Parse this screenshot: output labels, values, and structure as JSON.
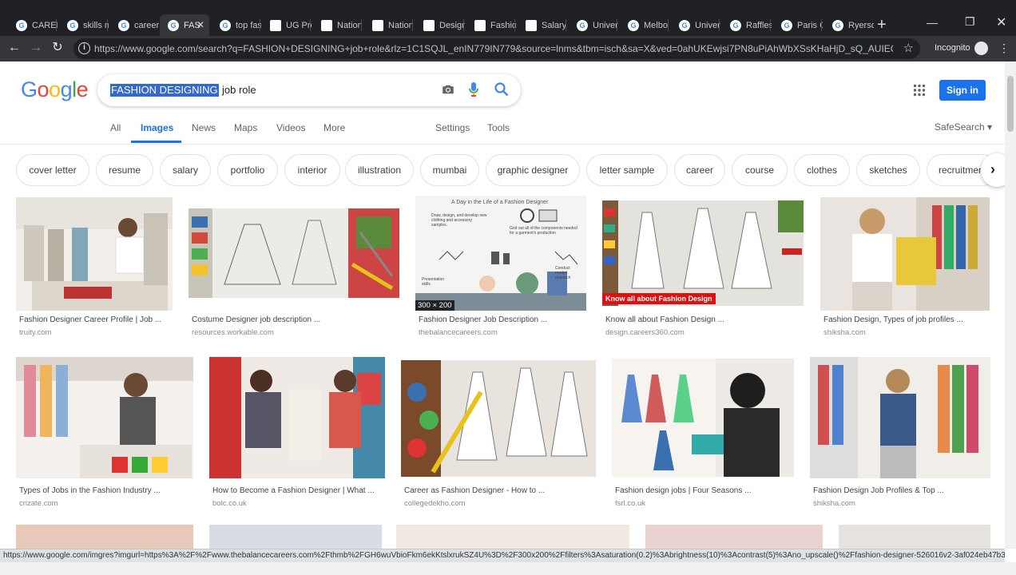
{
  "tabs": [
    {
      "label": "CAREE",
      "icon": "google"
    },
    {
      "label": "skills n",
      "icon": "google"
    },
    {
      "label": "career",
      "icon": "google"
    },
    {
      "label": "FAS",
      "icon": "google",
      "active": true
    },
    {
      "label": "top fas",
      "icon": "google"
    },
    {
      "label": "UG Pro",
      "icon": "site"
    },
    {
      "label": "Nation",
      "icon": "site"
    },
    {
      "label": "Nation",
      "icon": "site"
    },
    {
      "label": "Design",
      "icon": "site"
    },
    {
      "label": "Fashion",
      "icon": "site"
    },
    {
      "label": "Salary",
      "icon": "site"
    },
    {
      "label": "Univer",
      "icon": "google"
    },
    {
      "label": "Melbo",
      "icon": "google"
    },
    {
      "label": "Univer",
      "icon": "google"
    },
    {
      "label": "Raffles",
      "icon": "google"
    },
    {
      "label": "Paris C",
      "icon": "google"
    },
    {
      "label": "Ryerso",
      "icon": "google"
    }
  ],
  "browser": {
    "url": "https://www.google.com/search?q=FASHION+DESIGNING+job+role&rlz=1C1SQJL_enIN779IN779&source=lnms&tbm=isch&sa=X&ved=0ahUKEwjsi7PN8uPiAhWbXSsKHaHjD_sQ_AUIECgB&biw...",
    "incognito_label": "Incognito",
    "new_tab_glyph": "+",
    "status_url": "https://www.google.com/imgres?imgurl=https%3A%2F%2Fwww.thebalancecareers.com%2Fthmb%2FGH6wuVbioFkm6ekKtslxrukSZ4U%3D%2F300x200%2Ffilters%3Asaturation(0.2)%3Abrightness(10)%3Acontrast(5)%3Ano_upscale()%2Ffashion-designer-526016v2-3af024eb47b340b5..."
  },
  "google": {
    "logo_letters": [
      "G",
      "o",
      "o",
      "g",
      "l",
      "e"
    ],
    "logo_colors": [
      "#4285f4",
      "#ea4335",
      "#fbbc05",
      "#4285f4",
      "#34a853",
      "#ea4335"
    ],
    "query_selected": "FASHION DESIGNING",
    "query_rest": "job role",
    "sign_in": "Sign in",
    "safesearch": "SafeSearch ▾",
    "nav": [
      "All",
      "Images",
      "News",
      "Maps",
      "Videos",
      "More"
    ],
    "nav_active": "Images",
    "tools": [
      "Settings",
      "Tools"
    ]
  },
  "chips": [
    "cover letter",
    "resume",
    "salary",
    "portfolio",
    "interior",
    "illustration",
    "mumbai",
    "graphic designer",
    "letter sample",
    "career",
    "course",
    "clothes",
    "sketches",
    "recruitment"
  ],
  "results": [
    {
      "caption": "Fashion Designer Career Profile | Job ...",
      "source": "truity.com"
    },
    {
      "caption": "Costume Designer job description ...",
      "source": "resources.workable.com"
    },
    {
      "caption": "Fashion Designer Job Description ...",
      "source": "thebalancecareers.com",
      "badge": "300 × 200"
    },
    {
      "caption": "Know all about Fashion Design ...",
      "source": "design.careers360.com",
      "overlay": "Know all about Fashion Design"
    },
    {
      "caption": "Fashion Design, Types of job profiles ...",
      "source": "shiksha.com"
    },
    {
      "caption": "Types of Jobs in the Fashion Industry ...",
      "source": "crizate.com"
    },
    {
      "caption": "How to Become a Fashion Designer | What ...",
      "source": "bolc.co.uk"
    },
    {
      "caption": "Career as Fashion Designer - How to ...",
      "source": "collegedekho.com"
    },
    {
      "caption": "Fashion design jobs | Four Seasons ...",
      "source": "fsrl.co.uk"
    },
    {
      "caption": "Fashion Design Job Profiles & Top ...",
      "source": "shiksha.com"
    }
  ],
  "infographic": {
    "title": "A Day in the Life of a Fashion Designer",
    "notes": [
      "Draw, design, and develop new clothing and accessory samples.",
      "Grid out all of the components needed for a garment's production",
      "Presentation skills",
      "Conduct market research"
    ]
  }
}
